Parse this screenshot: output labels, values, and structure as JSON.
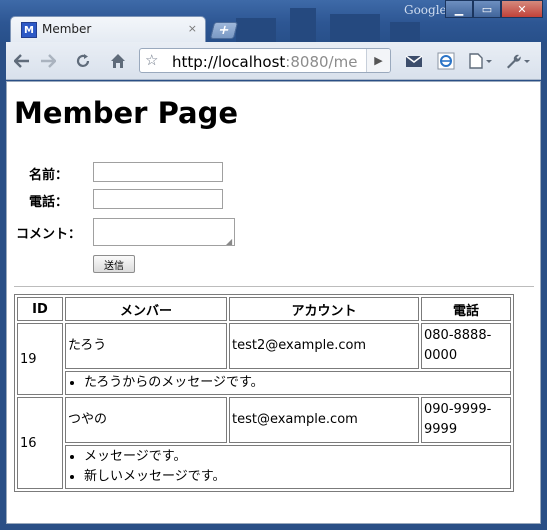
{
  "window": {
    "google_label": "Google",
    "controls": {
      "minimize": "▁",
      "maximize": "▭",
      "close": "✕"
    }
  },
  "tab": {
    "title": "Member",
    "favicon_glyph": "M",
    "close_glyph": "×",
    "new_tab_glyph": "+"
  },
  "toolbar": {
    "url_host": "http://localhost",
    "url_rest": ":8080/me",
    "icons": [
      "back-arrow-icon",
      "forward-arrow-icon",
      "reload-icon",
      "home-icon",
      "star-icon",
      "go-icon",
      "mail-icon",
      "ie-tab-icon",
      "page-menu-icon",
      "wrench-icon"
    ]
  },
  "page": {
    "heading": "Member Page",
    "form": {
      "name_label": "名前：",
      "name_value": "",
      "phone_label": "電話：",
      "phone_value": "",
      "comment_label": "コメント：",
      "comment_value": "",
      "submit_label": "送信"
    },
    "table": {
      "headers": {
        "id": "ID",
        "member": "メンバー",
        "account": "アカウント",
        "phone": "電話"
      },
      "rows": [
        {
          "id": "19",
          "name": "たろう",
          "account": "test2@example.com",
          "phone": "080-8888-0000",
          "messages": [
            "たろうからのメッセージです。"
          ]
        },
        {
          "id": "16",
          "name": "つやの",
          "account": "test@example.com",
          "phone": "090-9999-9999",
          "messages": [
            "メッセージです。",
            "新しいメッセージです。"
          ]
        }
      ]
    }
  },
  "colors": {
    "titlebar": "#2d5693",
    "toolbar": "#dfe6ef",
    "page_bg": "#ffffff",
    "table_border": "#7b7b7b"
  }
}
